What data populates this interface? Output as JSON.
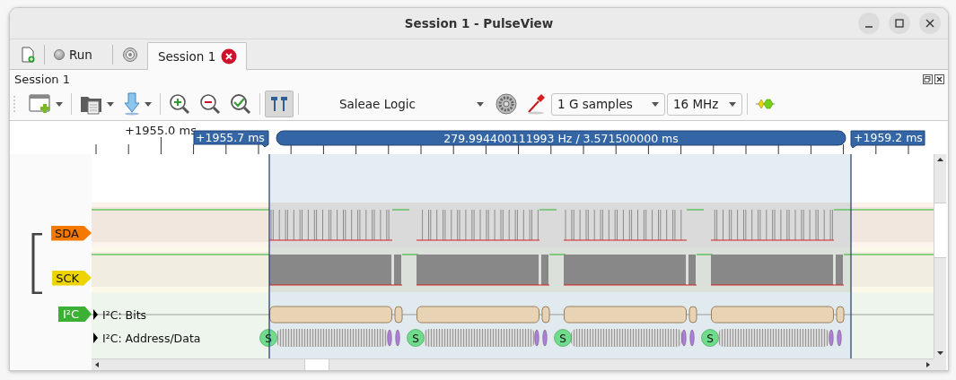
{
  "window": {
    "title": "Session 1 - PulseView"
  },
  "run_button": {
    "label": "Run"
  },
  "tabs": [
    {
      "label": "Session 1",
      "selected": true
    }
  ],
  "dock": {
    "title": "Session 1"
  },
  "toolbar": {
    "device": "Saleae Logic",
    "sample_count": "1 G samples",
    "sample_rate": "16 MHz",
    "cursors_on": true
  },
  "ruler": {
    "labels": [
      "+1955.0 ms"
    ],
    "cursor_start": "+1955.7 ms",
    "cursor_span": "279.994400111993 Hz / 3.571500000 ms",
    "cursor_end": "+1959.2 ms"
  },
  "channels": [
    {
      "name": "SDA",
      "color": "#f57900"
    },
    {
      "name": "SCK",
      "color": "#edd400"
    }
  ],
  "decoder": {
    "name": "I²C",
    "color": "#3cb034",
    "rows": [
      {
        "label": "I²C: Bits"
      },
      {
        "label": "I²C: Address/Data",
        "annotations": [
          "S",
          "S",
          "S",
          "S"
        ]
      }
    ]
  }
}
